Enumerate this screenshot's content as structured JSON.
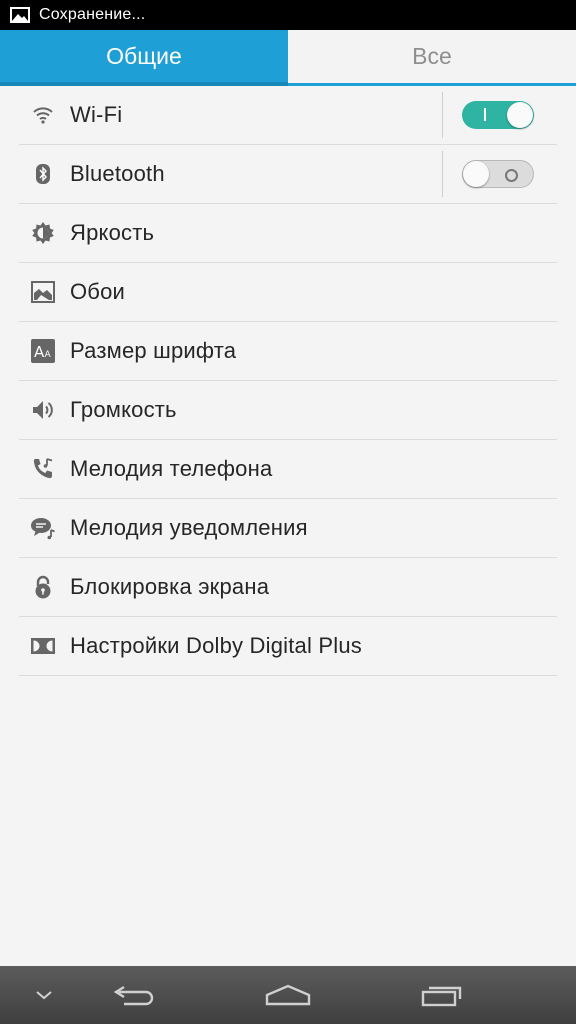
{
  "status_bar": {
    "text": "Сохранение...",
    "icon": "image-icon"
  },
  "tabs": [
    {
      "label": "Общие",
      "active": true
    },
    {
      "label": "Все",
      "active": false
    }
  ],
  "settings": [
    {
      "label": "Wi-Fi",
      "icon": "wifi-icon",
      "toggle": "on"
    },
    {
      "label": "Bluetooth",
      "icon": "bluetooth-icon",
      "toggle": "off"
    },
    {
      "label": "Яркость",
      "icon": "brightness-icon"
    },
    {
      "label": "Обои",
      "icon": "wallpaper-icon"
    },
    {
      "label": "Размер шрифта",
      "icon": "font-size-icon"
    },
    {
      "label": "Громкость",
      "icon": "volume-icon"
    },
    {
      "label": "Мелодия телефона",
      "icon": "phone-ringtone-icon"
    },
    {
      "label": "Мелодия уведомления",
      "icon": "notification-sound-icon"
    },
    {
      "label": "Блокировка экрана",
      "icon": "lock-icon"
    },
    {
      "label": "Настройки Dolby Digital Plus",
      "icon": "dolby-icon"
    }
  ],
  "nav_bar": [
    "chevron-down-icon",
    "back-icon",
    "home-icon",
    "recent-apps-icon"
  ],
  "colors": {
    "accent": "#1ea0d6",
    "toggle_on": "#2fb3a2",
    "background": "#f4f4f4"
  }
}
